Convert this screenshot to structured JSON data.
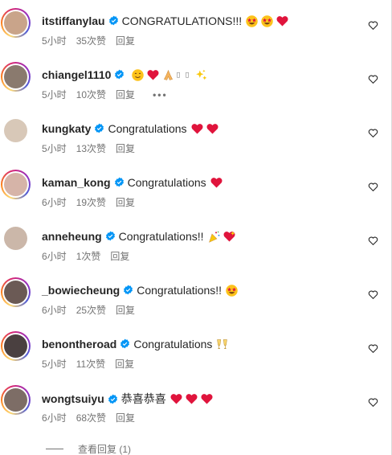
{
  "comments": [
    {
      "username": "itstiffanylau",
      "text": "CONGRATULATIONS!!!",
      "time": "5小时",
      "likes": "35次赞",
      "reply": "回复",
      "emojis": [
        "star-eyes-emoji",
        "star-eyes-emoji",
        "red-heart-emoji"
      ],
      "ring": true,
      "avatar_color": "#c9a48a",
      "more": ""
    },
    {
      "username": "chiangel1110",
      "text": "",
      "time": "5小时",
      "likes": "10次赞",
      "reply": "回复",
      "emojis": [
        "smiling-face-emoji",
        "red-heart-emoji",
        "folded-hands-emoji",
        "missing-glyph",
        "missing-glyph",
        "sparkles-emoji"
      ],
      "ring": true,
      "avatar_color": "#8a7a6e",
      "more": "•••"
    },
    {
      "username": "kungkaty",
      "text": "Congratulations",
      "time": "5小时",
      "likes": "13次赞",
      "reply": "回复",
      "emojis": [
        "red-heart-emoji",
        "red-heart-emoji"
      ],
      "ring": false,
      "avatar_color": "#d8c8b8",
      "more": ""
    },
    {
      "username": "kaman_kong",
      "text": "Congratulations",
      "time": "6小时",
      "likes": "19次赞",
      "reply": "回复",
      "emojis": [
        "red-heart-emoji"
      ],
      "ring": true,
      "avatar_color": "#d6b4a8",
      "more": ""
    },
    {
      "username": "anneheung",
      "text": "Congratulations!!",
      "time": "6小时",
      "likes": "1次赞",
      "reply": "回复",
      "emojis": [
        "party-popper-emoji",
        "sparkling-heart-emoji"
      ],
      "ring": false,
      "avatar_color": "#cbb7a9",
      "more": ""
    },
    {
      "username": "_bowiecheung",
      "text": "Congratulations!!",
      "time": "6小时",
      "likes": "25次赞",
      "reply": "回复",
      "emojis": [
        "star-eyes-emoji"
      ],
      "ring": true,
      "avatar_color": "#6b5a55",
      "more": ""
    },
    {
      "username": "benontheroad",
      "text": "Congratulations",
      "time": "5小时",
      "likes": "11次赞",
      "reply": "回复",
      "emojis": [
        "clinking-glasses-emoji"
      ],
      "ring": true,
      "avatar_color": "#4a4040",
      "more": ""
    },
    {
      "username": "wongtsuiyu",
      "text": "恭喜恭喜",
      "time": "6小时",
      "likes": "68次赞",
      "reply": "回复",
      "emojis": [
        "red-heart-emoji",
        "red-heart-emoji",
        "red-heart-emoji"
      ],
      "ring": true,
      "avatar_color": "#7d6d66",
      "more": ""
    }
  ],
  "view_replies": "查看回复 (1)",
  "colors": {
    "verified": "#0095f6",
    "secondary_text": "#737373",
    "heart": "#e0245e"
  }
}
